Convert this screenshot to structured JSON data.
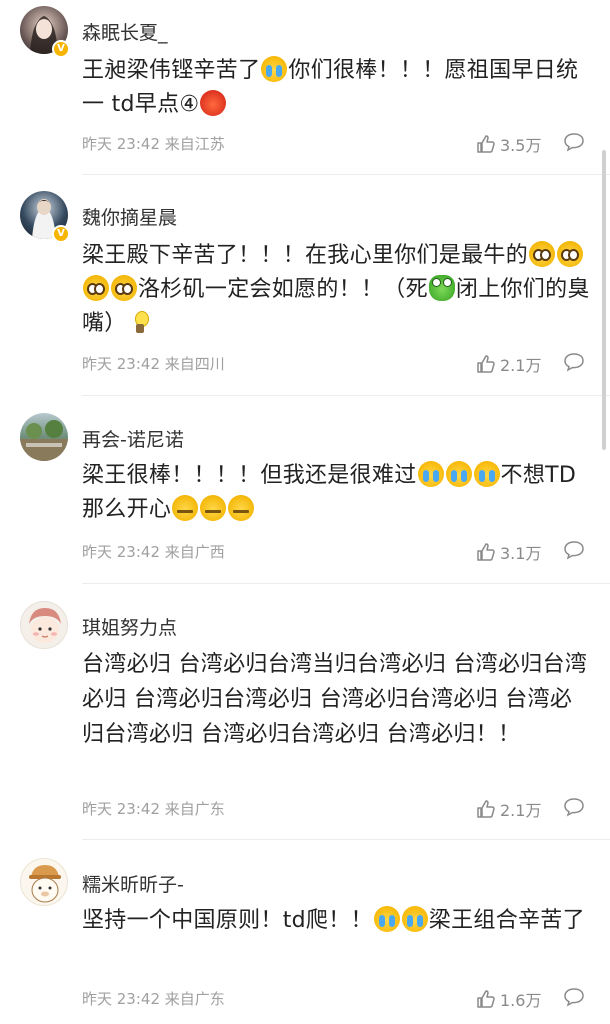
{
  "comments": [
    {
      "username": "森眠长夏_",
      "text_parts": [
        "王昶梁伟铿辛苦了",
        "你们很棒！！！愿祖国早日统一 td早点",
        "④"
      ],
      "meta": "昨天 23:42 来自江苏",
      "likes": "3.5万",
      "verified": true
    },
    {
      "username": "魏你摘星晨",
      "text_parts": [
        "梁王殿下辛苦了！！！在我心里你们是最牛的",
        "洛杉矶一定会如愿的！！（死",
        "闭上你们的臭嘴）"
      ],
      "meta": "昨天 23:42 来自四川",
      "likes": "2.1万",
      "verified": true
    },
    {
      "username": "再会-诺尼诺",
      "text_parts": [
        "梁王很棒！！！！但我还是很难过",
        "不想TD那么开心"
      ],
      "meta": "昨天 23:42 来自广西",
      "likes": "3.1万",
      "verified": false
    },
    {
      "username": "琪姐努力点",
      "text_parts": [
        "台湾必归 台湾必归台湾当归台湾必归 台湾必归台湾必归 台湾必归台湾必归 台湾必归台湾必归 台湾必归台湾必归 台湾必归台湾必归 台湾必归！！"
      ],
      "meta": "昨天 23:42 来自广东",
      "likes": "2.1万",
      "verified": false
    },
    {
      "username": "糯米昕昕子-",
      "text_parts": [
        "坚持一个中国原则！td爬！！",
        "梁王组合辛苦了"
      ],
      "meta": "昨天 23:42 来自广东",
      "likes": "1.6万",
      "verified": false
    }
  ],
  "icons": {
    "like": "thumbs-up-icon",
    "reply": "comment-bubble-icon",
    "emoji_cry": "crying-face-emoji",
    "emoji_angry": "angry-face-emoji",
    "emoji_plead": "pleading-face-emoji",
    "emoji_frog": "frog-emoji",
    "emoji_bulb": "lightbulb-emoji",
    "emoji_zip": "zipper-mouth-emoji"
  },
  "colors": {
    "verified_badge": "#f7b500",
    "meta_text": "#a0a0a0",
    "body_text": "#222222"
  }
}
